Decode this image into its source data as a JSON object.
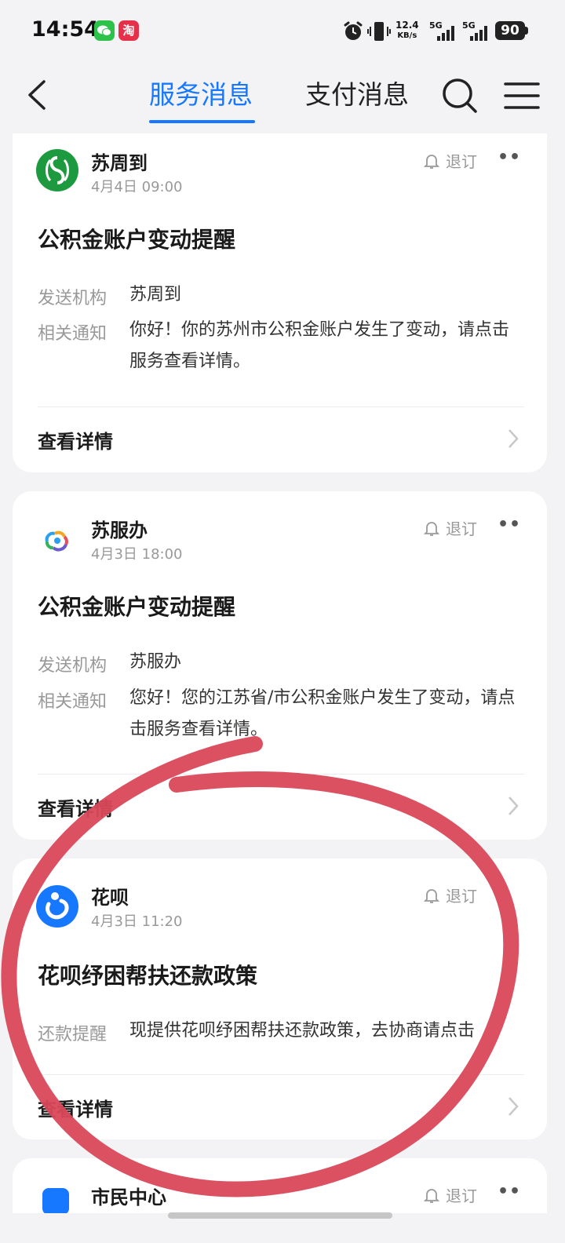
{
  "status_bar": {
    "time": "14:54",
    "wechat_icon": "wechat-app-icon",
    "taobao_glyph": "淘",
    "speed_value": "12.4",
    "speed_unit": "KB/s",
    "net1": "5G",
    "net2": "5G",
    "battery": "90"
  },
  "nav": {
    "tab_service": "服务消息",
    "tab_payment": "支付消息",
    "accent_color": "#1677ff"
  },
  "messages": [
    {
      "sender": "苏周到",
      "time": "4月4日 09:00",
      "unsubscribe": "退订",
      "title": "公积金账户变动提醒",
      "fields": [
        {
          "label": "发送机构",
          "value": "苏周到"
        },
        {
          "label": "相关通知",
          "value": "你好！你的苏州市公积金账户发生了变动，请点击服务查看详情。"
        }
      ],
      "detail_link": "查看详情"
    },
    {
      "sender": "苏服办",
      "time": "4月3日 18:00",
      "unsubscribe": "退订",
      "title": "公积金账户变动提醒",
      "fields": [
        {
          "label": "发送机构",
          "value": "苏服办"
        },
        {
          "label": "相关通知",
          "value": "您好！您的江苏省/市公积金账户发生了变动，请点击服务查看详情。"
        }
      ],
      "detail_link": "查看详情"
    },
    {
      "sender": "花呗",
      "time": "4月3日 11:20",
      "unsubscribe": "退订",
      "title": "花呗纾困帮扶还款政策",
      "fields": [
        {
          "label": "还款提醒",
          "value": "现提供花呗纾困帮扶还款政策，去协商请点击"
        }
      ],
      "detail_link": "查看详情"
    },
    {
      "sender": "市民中心",
      "unsubscribe": "退订"
    }
  ],
  "annotation_color": "#d9485a"
}
